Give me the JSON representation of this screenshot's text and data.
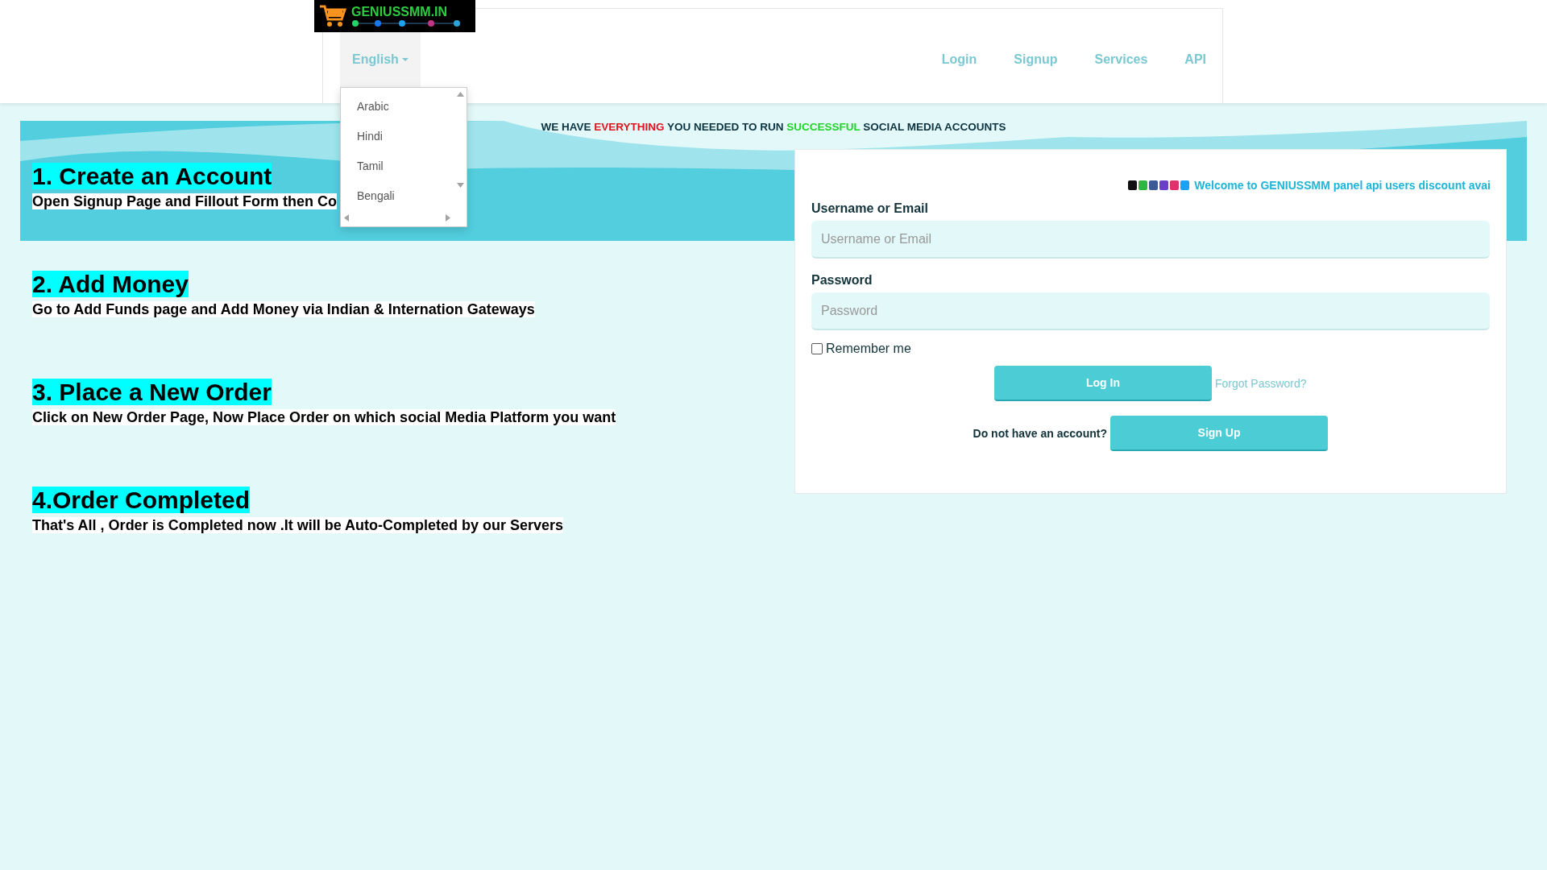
{
  "logo": {
    "text": "GENIUSSMM.IN"
  },
  "language_menu": {
    "label": "English",
    "open": true,
    "options": [
      {
        "label": "Arabic",
        "selected": false
      },
      {
        "label": "Hindi",
        "selected": false
      },
      {
        "label": "Tamil",
        "selected": false
      },
      {
        "label": "Bengali",
        "selected": false
      }
    ]
  },
  "nav": [
    "Login",
    "Signup",
    "Services",
    "API"
  ],
  "tagline": [
    {
      "text": "WE HAVE ",
      "color": "#0b3340"
    },
    {
      "text": "EVERYTHING",
      "color": "#e0141e"
    },
    {
      "text": " YOU NEEDED TO RUN ",
      "color": "#0b3340"
    },
    {
      "text": "SUCCESSFUL",
      "color": "#22d42a"
    },
    {
      "text": " SOCIAL MEDIA ACCOUNTS",
      "color": "#0b3340"
    }
  ],
  "steps": [
    {
      "title": "1. Create an Account",
      "text": "Open Signup Page and Fillout Form then Co"
    },
    {
      "title": "2. Add Money",
      "text": "Go to Add Funds page and Add Money via Indian & Internation Gateways"
    },
    {
      "title": "3. Place a New Order",
      "text": "Click on New Order Page, Now Place Order on which social Media Platform you want"
    },
    {
      "title": "4.Order Completed",
      "text": "That's All , Order is Completed now .It will be Auto-Completed by our Servers"
    }
  ],
  "login": {
    "announcement": "Welcome to GENIUSSMM panel api users discount avai",
    "username": {
      "label": "Username or Email",
      "placeholder": "Username or Email"
    },
    "password": {
      "label": "Password",
      "placeholder": "Password"
    },
    "remember": {
      "label": "Remember me",
      "checked": false
    },
    "login_button": "Log In",
    "forgot_link": "Forgot Password?",
    "signup_prompt": "Do not have an account?",
    "signup_button": "Sign Up"
  }
}
